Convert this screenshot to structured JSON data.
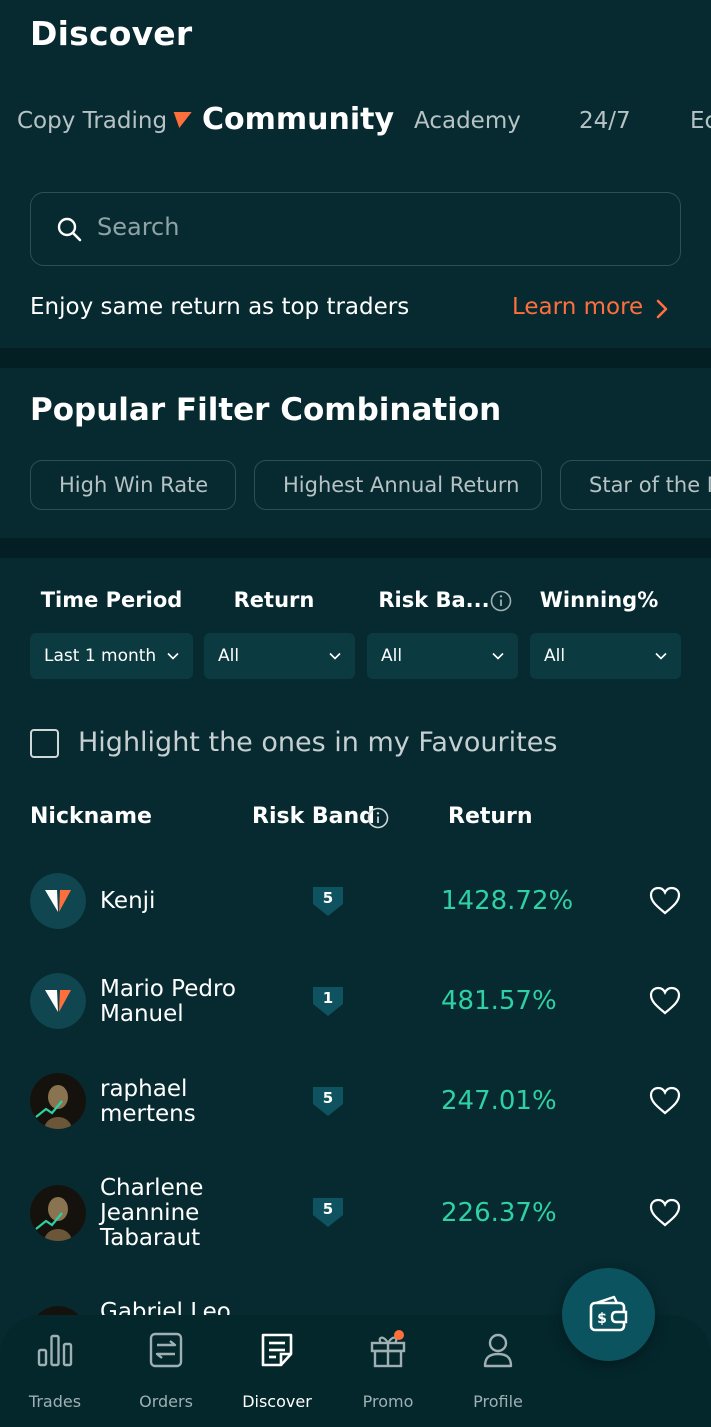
{
  "header": {
    "title": "Discover"
  },
  "tabs": [
    {
      "label": "Copy Trading",
      "active": false
    },
    {
      "label": "Community",
      "active": true
    },
    {
      "label": "Academy",
      "active": false
    },
    {
      "label": "24/7",
      "active": false
    },
    {
      "label": "Ec",
      "active": false
    }
  ],
  "search": {
    "placeholder": "Search"
  },
  "promo": {
    "text": "Enjoy same return as top traders",
    "link_label": "Learn more"
  },
  "popular": {
    "title": "Popular Filter Combination",
    "chips": [
      "High Win Rate",
      "Highest Annual Return",
      "Star of the M"
    ]
  },
  "filters": [
    {
      "label": "Time Period",
      "value": "Last 1 month"
    },
    {
      "label": "Return",
      "value": "All"
    },
    {
      "label": "Risk Ba...",
      "value": "All"
    },
    {
      "label": "Winning%",
      "value": "All"
    }
  ],
  "favourites": {
    "label": "Highlight the ones in my Favourites",
    "checked": false
  },
  "table": {
    "headers": {
      "nickname": "Nickname",
      "risk_band": "Risk Band",
      "return": "Return"
    },
    "rows": [
      {
        "name": "Kenji",
        "risk": "5",
        "return": "1428.72%",
        "avatar": "brand-logo"
      },
      {
        "name": "Mario Pedro Manuel",
        "risk": "1",
        "return": "481.57%",
        "avatar": "brand-logo"
      },
      {
        "name": "raphael mertens",
        "risk": "5",
        "return": "247.01%",
        "avatar": "statue-photo"
      },
      {
        "name": "Charlene Jeannine Tabaraut",
        "risk": "5",
        "return": "226.37%",
        "avatar": "statue-photo"
      },
      {
        "name": "Gabriel Leo",
        "risk": "",
        "return": "",
        "avatar": "statue-photo"
      }
    ]
  },
  "bottom_nav": [
    {
      "label": "Trades",
      "icon": "bar-chart-icon",
      "active": false
    },
    {
      "label": "Orders",
      "icon": "orders-icon",
      "active": false
    },
    {
      "label": "Discover",
      "icon": "discover-icon",
      "active": true
    },
    {
      "label": "Promo",
      "icon": "gift-icon",
      "active": false
    },
    {
      "label": "Profile",
      "icon": "profile-icon",
      "active": false
    }
  ],
  "colors": {
    "background": "#062a30",
    "accent": "#ff6f3c",
    "positive": "#2fd1a4",
    "badge": "#0f5260"
  }
}
